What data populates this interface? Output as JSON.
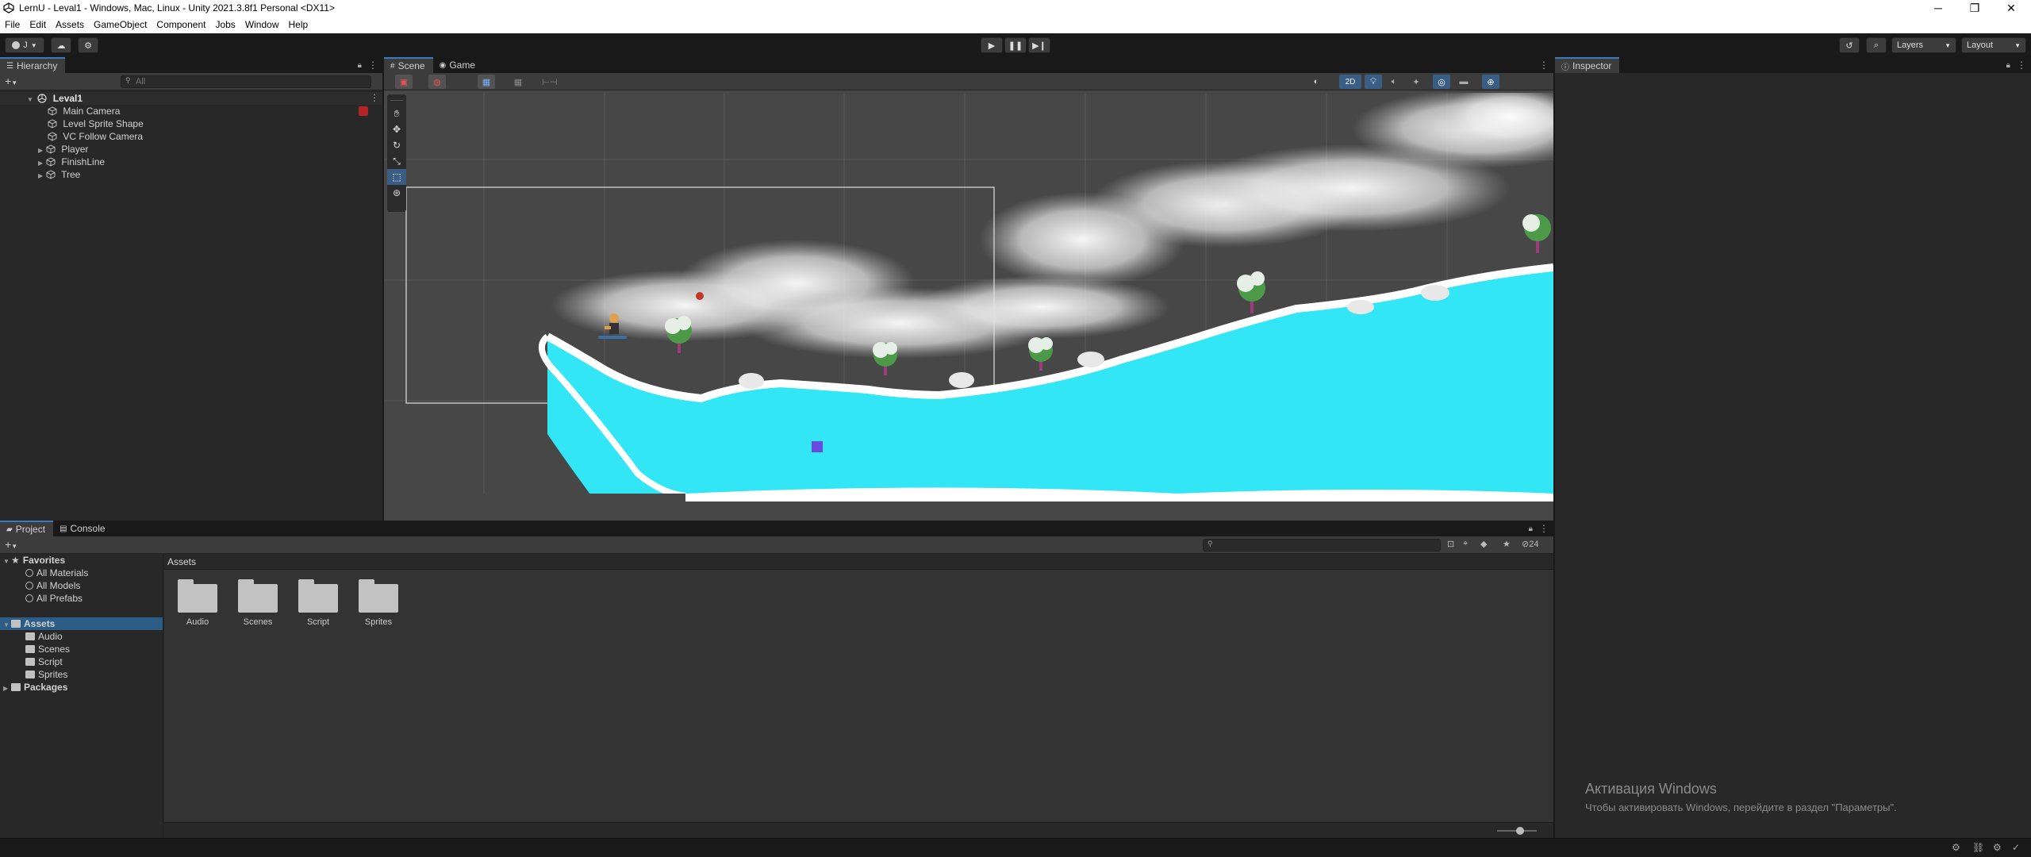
{
  "window": {
    "title": "LernU - Leval1 - Windows, Mac, Linux - Unity 2021.3.8f1 Personal <DX11>",
    "minimize": "─",
    "restore": "❐",
    "close": "✕"
  },
  "menu": [
    "File",
    "Edit",
    "Assets",
    "GameObject",
    "Component",
    "Jobs",
    "Window",
    "Help"
  ],
  "toolbar": {
    "account": "J",
    "layers": "Layers",
    "layout": "Layout"
  },
  "hierarchy": {
    "tab": "Hierarchy",
    "search_placeholder": "All",
    "scene": "Leval1",
    "items": [
      {
        "label": "Main Camera",
        "expandable": false
      },
      {
        "label": "Level Sprite Shape",
        "expandable": false
      },
      {
        "label": "VC Follow Camera",
        "expandable": false
      },
      {
        "label": "Player",
        "expandable": true
      },
      {
        "label": "FinishLine",
        "expandable": true
      },
      {
        "label": "Tree",
        "expandable": true
      }
    ]
  },
  "scene_view": {
    "tabs": [
      "Scene",
      "Game"
    ],
    "mode_2d": "2D"
  },
  "inspector": {
    "tab": "Inspector"
  },
  "project": {
    "tabs": [
      "Project",
      "Console"
    ],
    "favorites": {
      "label": "Favorites",
      "items": [
        "All Materials",
        "All Models",
        "All Prefabs"
      ]
    },
    "assets_tree": {
      "label": "Assets",
      "items": [
        "Audio",
        "Scenes",
        "Script",
        "Sprites"
      ]
    },
    "packages": "Packages",
    "breadcrumb": "Assets",
    "folders": [
      "Audio",
      "Scenes",
      "Script",
      "Sprites"
    ],
    "hidden_count": "24"
  },
  "watermark": {
    "line1": "Активация Windows",
    "line2": "Чтобы активировать Windows, перейдите в раздел \"Параметры\"."
  },
  "colors": {
    "accent": "#3a79bb",
    "water": "#33e6f5",
    "background": "#191919",
    "panel": "#282828"
  }
}
